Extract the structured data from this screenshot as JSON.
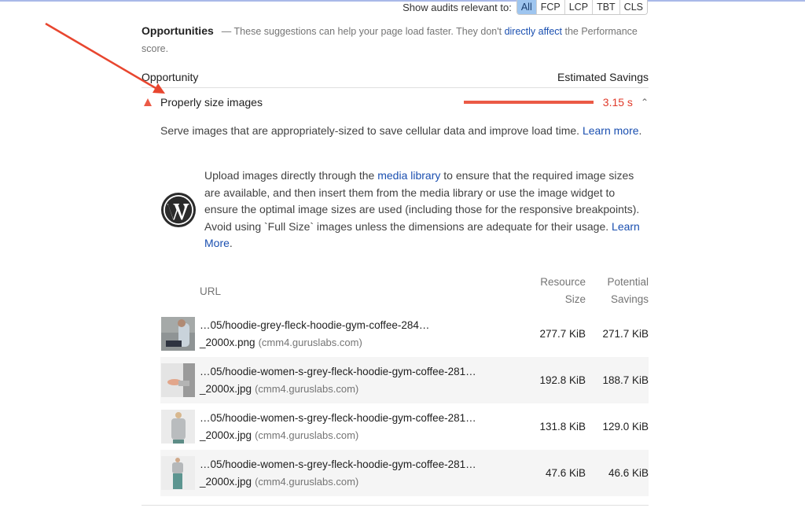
{
  "filter": {
    "label": "Show audits relevant to:",
    "options": [
      {
        "label": "All",
        "active": true
      },
      {
        "label": "FCP",
        "active": false
      },
      {
        "label": "LCP",
        "active": false
      },
      {
        "label": "TBT",
        "active": false
      },
      {
        "label": "CLS",
        "active": false
      }
    ]
  },
  "opportunities": {
    "title": "Opportunities",
    "desc_before": "— These suggestions can help your page load faster. They don't ",
    "desc_link": "directly affect",
    "desc_after": " the Performance score."
  },
  "columns": {
    "opportunity": "Opportunity",
    "savings": "Estimated Savings"
  },
  "audit": {
    "icon": "warning-triangle-icon",
    "title": "Properly size images",
    "savings": "3.15 s",
    "chevron": "^",
    "description": "Serve images that are appropriately-sized to save cellular data and improve load time. ",
    "description_link": "Learn more",
    "description_end": "."
  },
  "wordpress": {
    "icon": "wordpress-logo-icon",
    "text_before": "Upload images directly through the ",
    "link1": "media library",
    "text_middle": " to ensure that the required image sizes are available, and then insert them from the media library or use the image widget to ensure the optimal image sizes are used (including those for the responsive breakpoints). Avoid using `Full Size` images unless the dimensions are adequate for their usage. ",
    "link2": "Learn More",
    "text_end": "."
  },
  "table": {
    "headers": {
      "url": "URL",
      "resource_line1": "Resource",
      "resource_line2": "Size",
      "savings_line1": "Potential",
      "savings_line2": "Savings"
    },
    "rows": [
      {
        "url_line1": "…05/hoodie-grey-fleck-hoodie-gym-coffee-284…",
        "url_line2": "_2000x.png",
        "host": "(cmm4.guruslabs.com)",
        "size": "277.7 KiB",
        "savings": "271.7 KiB"
      },
      {
        "url_line1": "…05/hoodie-women-s-grey-fleck-hoodie-gym-coffee-281…",
        "url_line2": "_2000x.jpg",
        "host": "(cmm4.guruslabs.com)",
        "size": "192.8 KiB",
        "savings": "188.7 KiB"
      },
      {
        "url_line1": "…05/hoodie-women-s-grey-fleck-hoodie-gym-coffee-281…",
        "url_line2": "_2000x.jpg",
        "host": "(cmm4.guruslabs.com)",
        "size": "131.8 KiB",
        "savings": "129.0 KiB"
      },
      {
        "url_line1": "…05/hoodie-women-s-grey-fleck-hoodie-gym-coffee-281…",
        "url_line2": "_2000x.jpg",
        "host": "(cmm4.guruslabs.com)",
        "size": "47.6 KiB",
        "savings": "46.6 KiB"
      }
    ]
  },
  "colors": {
    "accent_red": "#eb5a46",
    "link_blue": "#1a4fb0",
    "active_pill": "#9ec5ef"
  }
}
